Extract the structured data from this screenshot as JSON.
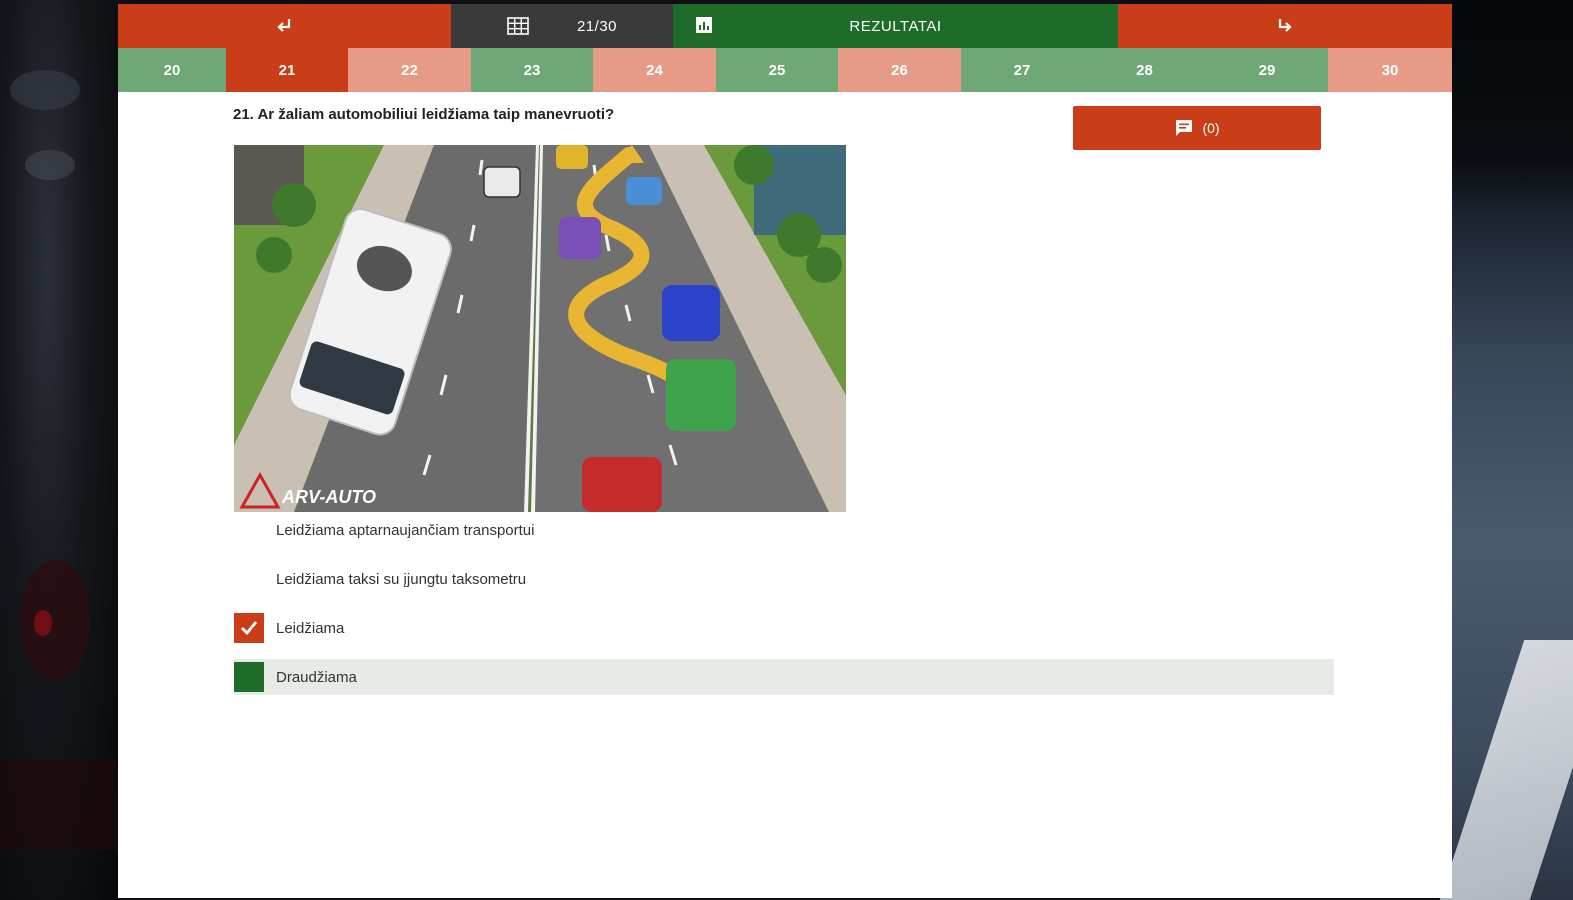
{
  "nav": {
    "prev_icon": "return-left-arrow",
    "counter_icon": "grid-icon",
    "counter_text": "21/30",
    "results_icon": "results-icon",
    "results_label": "REZULTATAI",
    "next_icon": "return-right-arrow"
  },
  "questions": [
    {
      "num": "20",
      "status": "correct"
    },
    {
      "num": "21",
      "status": "current"
    },
    {
      "num": "22",
      "status": "wrong"
    },
    {
      "num": "23",
      "status": "correct"
    },
    {
      "num": "24",
      "status": "wrong"
    },
    {
      "num": "25",
      "status": "correct"
    },
    {
      "num": "26",
      "status": "wrong"
    },
    {
      "num": "27",
      "status": "correct"
    },
    {
      "num": "28",
      "status": "correct"
    },
    {
      "num": "29",
      "status": "correct"
    },
    {
      "num": "30",
      "status": "wrong"
    }
  ],
  "question": {
    "text": "21. Ar žaliam automobiliui leidžiama taip manevruoti?",
    "comments_label": "(0)",
    "image_watermark": "ARV-AUTO"
  },
  "answers": [
    {
      "text": "Leidžiama aptarnaujančiam transportui",
      "state": "none"
    },
    {
      "text": "Leidžiama taksi su įjungtu taksometru",
      "state": "none"
    },
    {
      "text": "Leidžiama",
      "state": "selected"
    },
    {
      "text": "Draudžiama",
      "state": "correct"
    }
  ],
  "colors": {
    "primary_red": "#c93e19",
    "dark_green": "#1e6b2a",
    "light_green": "#6ea876",
    "light_red": "#e79a85",
    "counter_bg": "#3a3a3a",
    "highlight_bg": "#e6ebe6"
  }
}
